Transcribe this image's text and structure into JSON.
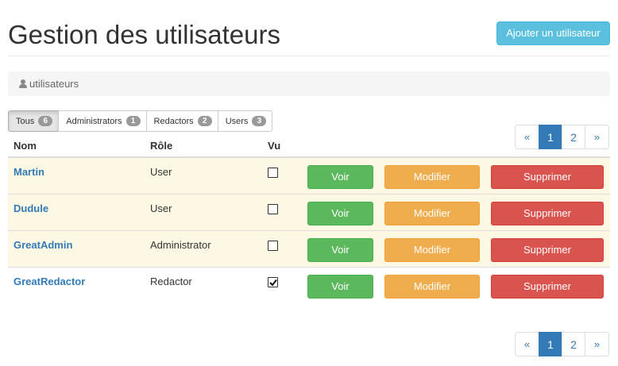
{
  "header": {
    "title": "Gestion des utilisateurs",
    "add_button": "Ajouter un utilisateur"
  },
  "breadcrumb": {
    "icon": "user-icon",
    "label": "utilisateurs"
  },
  "filters": [
    {
      "label": "Tous",
      "count": "6",
      "active": true
    },
    {
      "label": "Administrators",
      "count": "1",
      "active": false
    },
    {
      "label": "Redactors",
      "count": "2",
      "active": false
    },
    {
      "label": "Users",
      "count": "3",
      "active": false
    }
  ],
  "pagination": {
    "prev": "«",
    "pages": [
      "1",
      "2"
    ],
    "current": "1",
    "next": "»"
  },
  "table": {
    "columns": [
      "Nom",
      "Rôle",
      "Vu"
    ],
    "actions": {
      "view": "Voir",
      "edit": "Modifier",
      "delete": "Supprimer"
    },
    "rows": [
      {
        "name": "Martin",
        "role": "User",
        "seen": false,
        "highlighted": true
      },
      {
        "name": "Dudule",
        "role": "User",
        "seen": false,
        "highlighted": true
      },
      {
        "name": "GreatAdmin",
        "role": "Administrator",
        "seen": false,
        "highlighted": true
      },
      {
        "name": "GreatRedactor",
        "role": "Redactor",
        "seen": true,
        "highlighted": false
      }
    ]
  },
  "colors": {
    "info": "#5bc0de",
    "primary": "#337ab7",
    "success": "#5cb85c",
    "warning": "#f0ad4e",
    "danger": "#d9534f",
    "row_highlight": "#fcf8e3"
  }
}
